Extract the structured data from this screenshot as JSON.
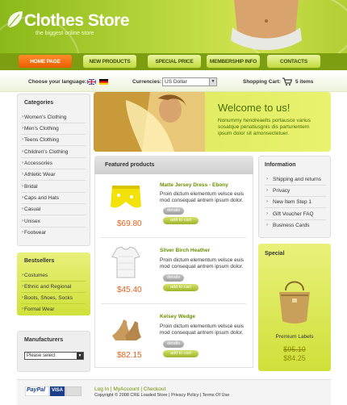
{
  "header": {
    "title": "Clothes Store",
    "subtitle": "the biggest online store"
  },
  "nav": {
    "items": [
      {
        "label": "Home Page",
        "active": true
      },
      {
        "label": "New Products",
        "active": false
      },
      {
        "label": "Special Price",
        "active": false
      },
      {
        "label": "Membership Info",
        "active": false
      },
      {
        "label": "Contacts",
        "active": false
      }
    ]
  },
  "utility": {
    "language_label": "Choose your language:",
    "languages": [
      "uk-flag-icon",
      "de-flag-icon"
    ],
    "currency_label": "Currencies:",
    "currency_value": "US Dollar",
    "cart_label": "Shopping Cart:",
    "cart_count": "5 items"
  },
  "categories": {
    "title": "Categories",
    "items": [
      "Women's Clothing",
      "Men's Clothing",
      "Teens Clothing",
      "Children's Clothing",
      "Accessories",
      "Athletic Wear",
      "Bridal",
      "Caps and Hats",
      "Casual",
      "Unisex",
      "Footwear"
    ]
  },
  "bestsellers": {
    "title": "Bestsellers",
    "items": [
      "Costumes",
      "Ethnic and Regional",
      "Boots, Shoes, Socks",
      "Formal Wear"
    ]
  },
  "manufacturers": {
    "title": "Manufacturers",
    "select_value": "Please select"
  },
  "welcome": {
    "title": "Welcome to us!",
    "text": "Nonummy hendreaelts portausce varius sosatque penatiusgnis dis parturientem ipsum dolor sit amonsectetuer."
  },
  "featured": {
    "title": "Featured products",
    "details_label": "details",
    "cart_label": "add to cart",
    "products": [
      {
        "name": "Matte Jersey Dress - Ebony",
        "desc": "Proin dictum elementum velsce euis mod consequat antrem ipsum dolor.",
        "price": "$69.80"
      },
      {
        "name": "Silver Birch Heather",
        "desc": "Proin dictum elementum velsce euis mod consequat antrem ipsum dolor.",
        "price": "$45.40"
      },
      {
        "name": "Kelsey Wedge",
        "desc": "Proin dictum elementum velsce euis mod consequat antrem ipsum dolor.",
        "price": "$82.15"
      }
    ]
  },
  "information": {
    "title": "Information",
    "items": [
      "Shipping and returns",
      "Privacy",
      "New Item Step 1",
      "Gift Voucher FAQ",
      "Business Cards"
    ]
  },
  "special": {
    "title": "Special",
    "name": "Premium Labels",
    "old_price": "$95.10",
    "new_price": "$84.25"
  },
  "footer": {
    "links": "Log In  |  MyAccount  |  Checkout",
    "copyright": "Copyright © 2008 CRE Loaded Store  |  Privacy Policy  |  Terms Of Use",
    "payment_labels": [
      "PayPal",
      "VISA"
    ]
  },
  "colors": {
    "brand_green": "#8bb81a",
    "accent_orange": "#e85f00",
    "price_orange": "#e8601a"
  }
}
